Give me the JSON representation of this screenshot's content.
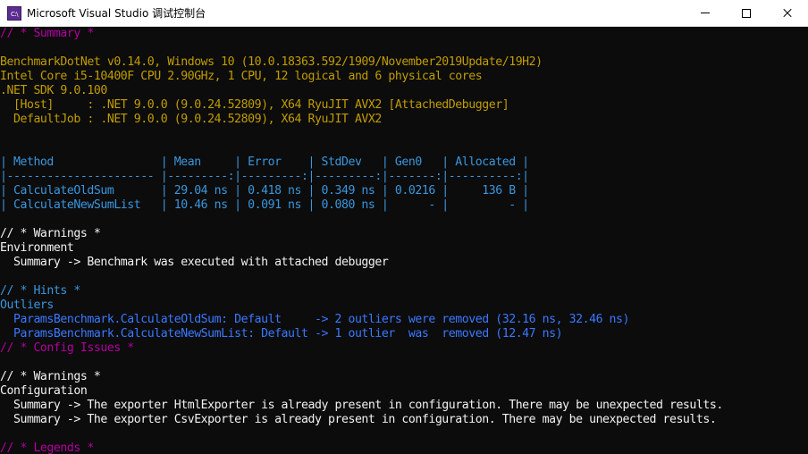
{
  "window": {
    "title": "Microsoft Visual Studio 调试控制台",
    "icon_text": "C:\\"
  },
  "console_lines": [
    {
      "text": "// * Summary *",
      "color": "magenta"
    },
    {
      "text": "",
      "color": "gray"
    },
    {
      "text": "BenchmarkDotNet v0.14.0, Windows 10 (10.0.18363.592/1909/November2019Update/19H2)",
      "color": "yellow"
    },
    {
      "text": "Intel Core i5-10400F CPU 2.90GHz, 1 CPU, 12 logical and 6 physical cores",
      "color": "yellow"
    },
    {
      "text": ".NET SDK 9.0.100",
      "color": "yellow"
    },
    {
      "text": "  [Host]     : .NET 9.0.0 (9.0.24.52809), X64 RyuJIT AVX2 [AttachedDebugger]",
      "color": "yellow"
    },
    {
      "text": "  DefaultJob : .NET 9.0.0 (9.0.24.52809), X64 RyuJIT AVX2",
      "color": "yellow"
    },
    {
      "text": "",
      "color": "gray"
    },
    {
      "text": "",
      "color": "gray"
    },
    {
      "text": "| Method                | Mean     | Error    | StdDev   | Gen0   | Allocated |",
      "color": "cyan"
    },
    {
      "text": "|---------------------- |---------:|---------:|---------:|-------:|----------:|",
      "color": "cyan"
    },
    {
      "text": "| CalculateOldSum       | 29.04 ns | 0.418 ns | 0.349 ns | 0.0216 |     136 B |",
      "color": "cyan"
    },
    {
      "text": "| CalculateNewSumList   | 10.46 ns | 0.091 ns | 0.080 ns |      - |         - |",
      "color": "cyan"
    },
    {
      "text": "",
      "color": "gray"
    },
    {
      "text": "// * Warnings *",
      "color": "white"
    },
    {
      "text": "Environment",
      "color": "white"
    },
    {
      "text": "  Summary -> Benchmark was executed with attached debugger",
      "color": "white"
    },
    {
      "text": "",
      "color": "gray"
    },
    {
      "text": "// * Hints *",
      "color": "cyan"
    },
    {
      "text": "Outliers",
      "color": "cyan"
    },
    {
      "text": "  ParamsBenchmark.CalculateOldSum: Default     -> 2 outliers were removed (32.16 ns, 32.46 ns)",
      "color": "blue"
    },
    {
      "text": "  ParamsBenchmark.CalculateNewSumList: Default -> 1 outlier  was  removed (12.47 ns)",
      "color": "blue"
    },
    {
      "text": "// * Config Issues *",
      "color": "magenta"
    },
    {
      "text": "",
      "color": "gray"
    },
    {
      "text": "// * Warnings *",
      "color": "white"
    },
    {
      "text": "Configuration",
      "color": "white"
    },
    {
      "text": "  Summary -> The exporter HtmlExporter is already present in configuration. There may be unexpected results.",
      "color": "white"
    },
    {
      "text": "  Summary -> The exporter CsvExporter is already present in configuration. There may be unexpected results.",
      "color": "white"
    },
    {
      "text": "",
      "color": "gray"
    },
    {
      "text": "// * Legends *",
      "color": "magenta"
    }
  ],
  "colors": {
    "background": "#0c0c0c",
    "magenta": "#b4009e",
    "yellow": "#c19c00",
    "cyan": "#3a96dd",
    "blue": "#3b78ff",
    "white": "#f2f2f2"
  }
}
